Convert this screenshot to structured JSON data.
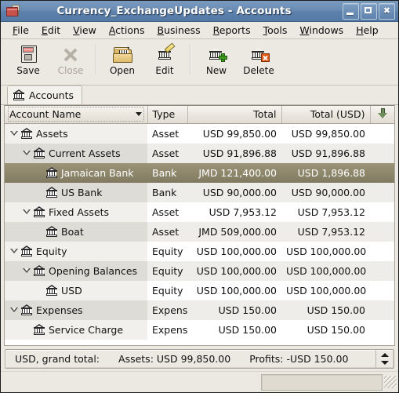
{
  "window": {
    "title": "Currency_ExchangeUpdates - Accounts",
    "icon": "gnucash-icon",
    "buttons": {
      "minimize": "_",
      "maximize": "□",
      "close": "×"
    }
  },
  "menubar": {
    "items": [
      {
        "label": "File",
        "accel": "F"
      },
      {
        "label": "Edit",
        "accel": "E"
      },
      {
        "label": "View",
        "accel": "V"
      },
      {
        "label": "Actions",
        "accel": "A"
      },
      {
        "label": "Business",
        "accel": "B"
      },
      {
        "label": "Reports",
        "accel": "R"
      },
      {
        "label": "Tools",
        "accel": "T"
      },
      {
        "label": "Windows",
        "accel": "W"
      },
      {
        "label": "Help",
        "accel": "H"
      }
    ]
  },
  "toolbar": {
    "buttons": [
      {
        "label": "Save",
        "icon": "floppy-disk-icon",
        "enabled": true
      },
      {
        "label": "Close",
        "icon": "close-x-icon",
        "enabled": false
      },
      {
        "label": "Open",
        "icon": "open-folder-icon",
        "enabled": true
      },
      {
        "label": "Edit",
        "icon": "edit-pencil-icon",
        "enabled": true
      },
      {
        "label": "New",
        "icon": "new-account-icon",
        "enabled": true
      },
      {
        "label": "Delete",
        "icon": "delete-account-icon",
        "enabled": true
      }
    ]
  },
  "tabs": [
    {
      "label": "Accounts",
      "icon": "bank-icon",
      "active": true
    }
  ],
  "table": {
    "columns": [
      {
        "key": "name",
        "label": "Account Name",
        "align": "left",
        "sortable": true
      },
      {
        "key": "type",
        "label": "Type",
        "align": "left"
      },
      {
        "key": "total",
        "label": "Total",
        "align": "right"
      },
      {
        "key": "totalusd",
        "label": "Total (USD)",
        "align": "right"
      }
    ],
    "options_icon": "down-arrow-icon",
    "rows": [
      {
        "name": "Assets",
        "type": "Asset",
        "total": "USD 99,850.00",
        "totalusd": "USD 99,850.00",
        "depth": 0,
        "expander": "expanded",
        "selected": false
      },
      {
        "name": "Current Assets",
        "type": "Asset",
        "total": "USD 91,896.88",
        "totalusd": "USD 91,896.88",
        "depth": 1,
        "expander": "expanded",
        "selected": false
      },
      {
        "name": "Jamaican Bank",
        "type": "Bank",
        "total": "JMD 121,400.00",
        "totalusd": "USD 1,896.88",
        "depth": 2,
        "expander": "none",
        "selected": true
      },
      {
        "name": "US Bank",
        "type": "Bank",
        "total": "USD 90,000.00",
        "totalusd": "USD 90,000.00",
        "depth": 2,
        "expander": "none",
        "selected": false
      },
      {
        "name": "Fixed Assets",
        "type": "Asset",
        "total": "USD 7,953.12",
        "totalusd": "USD 7,953.12",
        "depth": 1,
        "expander": "expanded",
        "selected": false
      },
      {
        "name": "Boat",
        "type": "Asset",
        "total": "JMD 509,000.00",
        "totalusd": "USD 7,953.12",
        "depth": 2,
        "expander": "none",
        "selected": false
      },
      {
        "name": "Equity",
        "type": "Equity",
        "total": "USD 100,000.00",
        "totalusd": "USD 100,000.00",
        "depth": 0,
        "expander": "expanded",
        "selected": false
      },
      {
        "name": "Opening Balances",
        "type": "Equity",
        "total": "USD 100,000.00",
        "totalusd": "USD 100,000.00",
        "depth": 1,
        "expander": "expanded",
        "selected": false
      },
      {
        "name": "USD",
        "type": "Equity",
        "total": "USD 100,000.00",
        "totalusd": "USD 100,000.00",
        "depth": 2,
        "expander": "none",
        "selected": false
      },
      {
        "name": "Expenses",
        "type": "Expens",
        "total": "USD 150.00",
        "totalusd": "USD 150.00",
        "depth": 0,
        "expander": "expanded",
        "selected": false
      },
      {
        "name": "Service Charge",
        "type": "Expens",
        "total": "USD 150.00",
        "totalusd": "USD 150.00",
        "depth": 1,
        "expander": "none",
        "selected": false
      }
    ]
  },
  "summary": {
    "currency_label": "USD, grand total:",
    "assets_label": "Assets: USD 99,850.00",
    "profits_label": "Profits: -USD 150.00",
    "spinner_icon": "spinner-updown-icon"
  },
  "statusbar": {
    "text": "",
    "grip_icon": "resize-grip-icon"
  },
  "colors": {
    "titlebar": "#6b8cb3",
    "selection": "#8e876c",
    "window_bg": "#ece9e2",
    "row_alt": "#eeedea"
  }
}
